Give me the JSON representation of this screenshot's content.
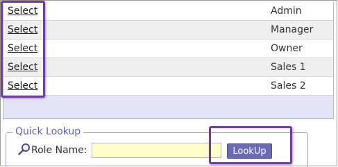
{
  "grid": {
    "rows": [
      {
        "select_label": "Select",
        "role": "Admin"
      },
      {
        "select_label": "Select",
        "role": "Manager"
      },
      {
        "select_label": "Select",
        "role": "Owner"
      },
      {
        "select_label": "Select",
        "role": "Sales 1"
      },
      {
        "select_label": "Select",
        "role": "Sales 2"
      }
    ]
  },
  "quick_lookup": {
    "legend": "Quick Lookup",
    "role_name_label": "Role Name:",
    "role_name_value": "",
    "button_label": "LookUp",
    "icon": "search-icon"
  },
  "colors": {
    "highlight": "#6e3f9e",
    "button_bg": "#6a6ab5",
    "input_bg": "#ffffcc",
    "legend_text": "#5b5fb5",
    "footer_bg": "#e4e4f7"
  }
}
